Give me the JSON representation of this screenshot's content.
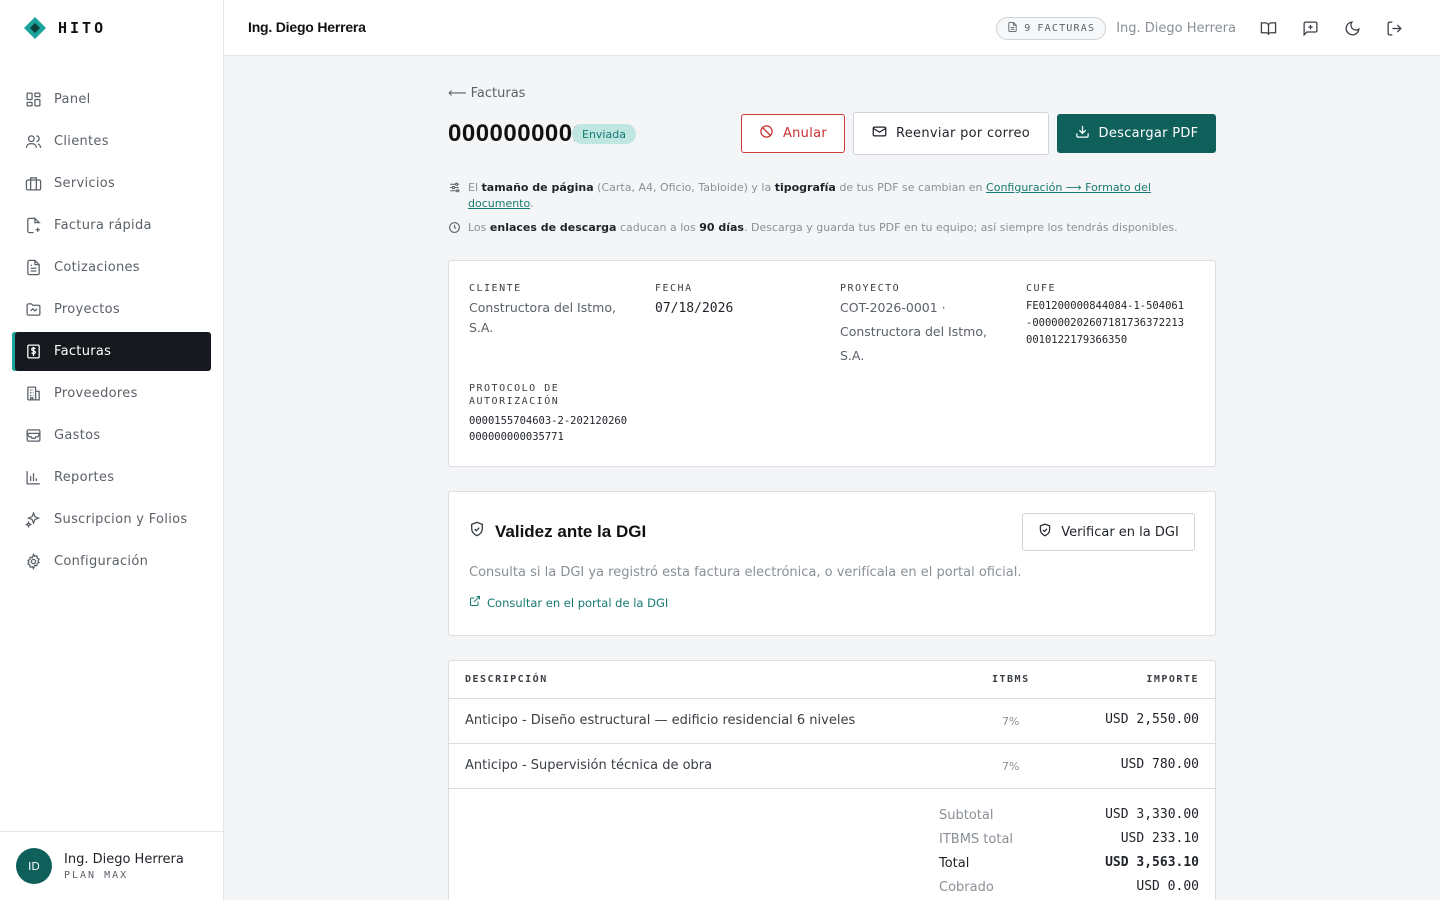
{
  "brand": {
    "name": "HITO"
  },
  "sidebar": {
    "items": [
      {
        "label": "Panel",
        "icon": "grid-icon"
      },
      {
        "label": "Clientes",
        "icon": "users-icon"
      },
      {
        "label": "Servicios",
        "icon": "briefcase-icon"
      },
      {
        "label": "Factura rápida",
        "icon": "file-plus-icon"
      },
      {
        "label": "Cotizaciones",
        "icon": "file-text-icon"
      },
      {
        "label": "Proyectos",
        "icon": "folder-icon"
      },
      {
        "label": "Facturas",
        "icon": "invoice-dollar-icon",
        "active": true
      },
      {
        "label": "Proveedores",
        "icon": "building-icon"
      },
      {
        "label": "Gastos",
        "icon": "inbox-icon"
      },
      {
        "label": "Reportes",
        "icon": "bar-chart-icon"
      },
      {
        "label": "Suscripcion y Folios",
        "icon": "sparkles-icon"
      },
      {
        "label": "Configuración",
        "icon": "gear-icon"
      }
    ],
    "user": {
      "initials": "ID",
      "name": "Ing. Diego Herrera",
      "plan": "PLAN MAX"
    }
  },
  "topbar": {
    "title": "Ing. Diego Herrera",
    "invoice_count": "9",
    "invoice_count_label": "FACTURAS",
    "user_name": "Ing. Diego Herrera"
  },
  "invoice": {
    "back_label": "Facturas",
    "number": "0000000001",
    "status": "Enviada",
    "actions": {
      "void": "Anular",
      "resend": "Reenviar por correo",
      "download": "Descargar PDF"
    },
    "notes": {
      "format_1": "El ",
      "format_bold_1": "tamaño de página",
      "format_2": " (Carta, A4, Oficio, Tabloide) y la ",
      "format_bold_2": "tipografía",
      "format_3": " de tus PDF se cambian en ",
      "format_link": "Configuración ⟶ Formato del documento",
      "format_4": ".",
      "expiry_1": "Los ",
      "expiry_bold_1": "enlaces de descarga",
      "expiry_2": " caducan a los ",
      "expiry_bold_2": "90 días",
      "expiry_3": ". Descarga y guarda tus PDF en tu equipo; así siempre los tendrás disponibles."
    },
    "meta": {
      "client_label": "CLIENTE",
      "client_value": "Constructora del Istmo, S.A.",
      "date_label": "FECHA",
      "date_value": "07/18/2026",
      "project_label": "PROYECTO",
      "project_value": "COT-2026-0001 · Constructora del Istmo, S.A.",
      "cufe_label": "CUFE",
      "cufe_line1": "FE01200000844084-1-504061",
      "cufe_line2": "-00000020260718173637221З",
      "cufe_line3": "0010122179366350",
      "protocol_label_1": "PROTOCOLO DE",
      "protocol_label_2": "AUTORIZACIÓN",
      "protocol_line1": "0000155704603-2-202120260",
      "protocol_line2": "000000000035771"
    },
    "dgi": {
      "title": "Validez ante la DGI",
      "verify_button": "Verificar en la DGI",
      "description": "Consulta si la DGI ya registró esta factura electrónica, o verifícala en el portal oficial.",
      "portal_link": "Consultar en el portal de la DGI"
    },
    "table": {
      "headers": {
        "description": "DESCRIPCIÓN",
        "tax": "ITBMS",
        "amount": "IMPORTE"
      },
      "rows": [
        {
          "description": "Anticipo - Diseño estructural — edificio residencial 6 niveles",
          "tax": "7%",
          "amount": "USD 2,550.00"
        },
        {
          "description": "Anticipo - Supervisión técnica de obra",
          "tax": "7%",
          "amount": "USD 780.00"
        }
      ],
      "totals": [
        {
          "label": "Subtotal",
          "value": "USD 3,330.00"
        },
        {
          "label": "ITBMS total",
          "value": "USD 233.10"
        },
        {
          "label": "Total",
          "value": "USD 3,563.10"
        },
        {
          "label": "Cobrado",
          "value": "USD 0.00"
        }
      ]
    }
  },
  "colors": {
    "accent": "#0f5f5a",
    "accent_light": "#1aa39a",
    "danger": "#d23a3a",
    "status_bg": "#bfe6e1"
  }
}
